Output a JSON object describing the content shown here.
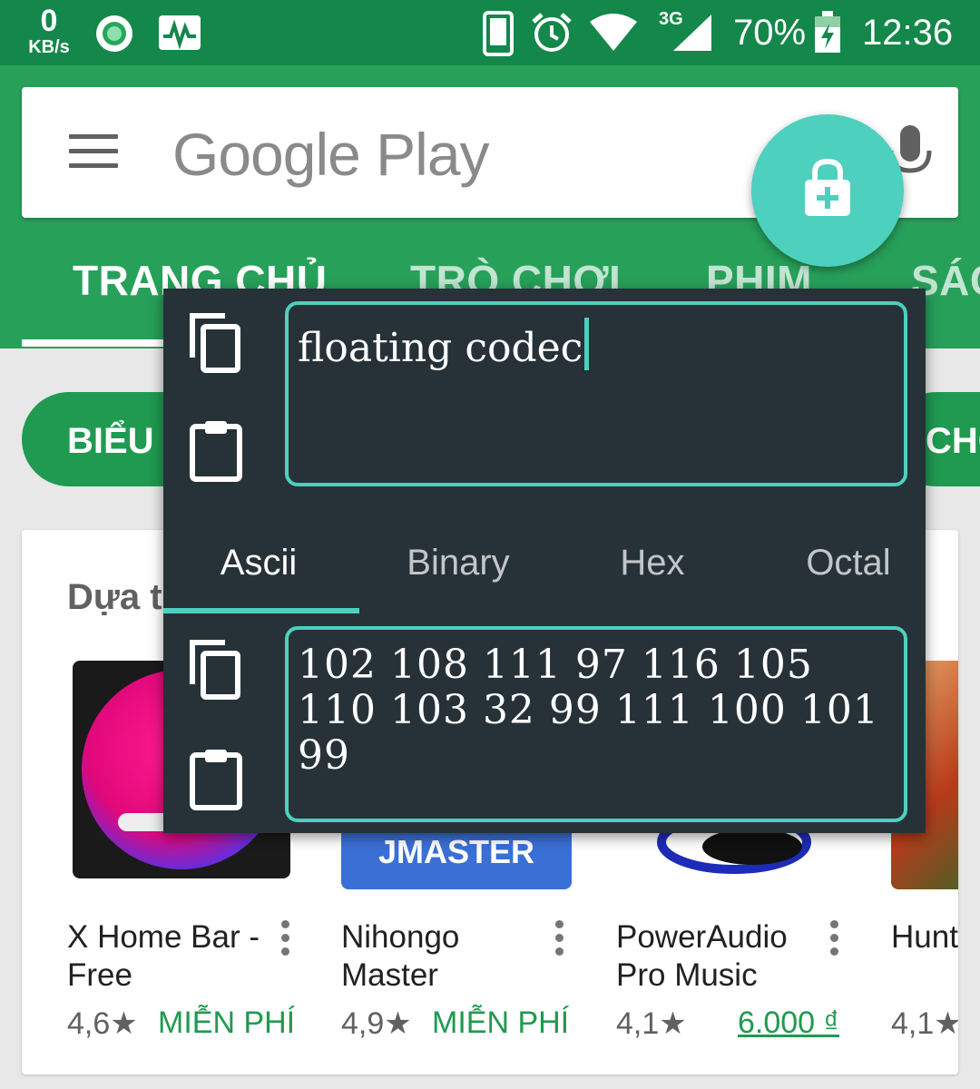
{
  "status_bar": {
    "net_speed_value": "0",
    "net_speed_unit": "KB/s",
    "network_type": "3G",
    "battery": "70%",
    "time": "12:36"
  },
  "search": {
    "logo_text": "Google Play"
  },
  "tabs": [
    {
      "label": "TRANG CHỦ",
      "active": true
    },
    {
      "label": "TRÒ CHƠI",
      "active": false
    },
    {
      "label": "PHIM",
      "active": false
    },
    {
      "label": "SÁC",
      "active": false
    }
  ],
  "chips": {
    "left": "BIỂU ĐỒ",
    "right": "CHO"
  },
  "card": {
    "title": "Dựa trên",
    "apps": [
      {
        "name": "X Home Bar - Free",
        "rating": "4,6★",
        "price": "MIỄN PHÍ"
      },
      {
        "name": "Nihongo Master",
        "rating": "4,9★",
        "price": "MIỄN PHÍ",
        "thumb_text": "JMASTER"
      },
      {
        "name": "PowerAudio Pro Music",
        "rating": "4,1★",
        "price": "6.000 ₫"
      },
      {
        "name": "Hunt Lege",
        "rating": "4,1★",
        "price": ""
      }
    ]
  },
  "overlay": {
    "input_text": "floating codec",
    "tabs": [
      "Ascii",
      "Binary",
      "Hex",
      "Octal"
    ],
    "active_tab": "Ascii",
    "output_text": "102 108 111 97 116 105 110 103 32 99 111 100 101 99"
  },
  "colors": {
    "status_bar": "#14874a",
    "app_bar": "#27a05a",
    "accent": "#4dd0be",
    "overlay_bg": "#263238",
    "price_green": "#1f9a50"
  },
  "icons": {
    "status": [
      "netspeed",
      "circle-app-icon",
      "activity-monitor-icon",
      "phone-icon",
      "alarm-icon",
      "wifi-icon",
      "signal-icon",
      "battery-charging-icon"
    ],
    "overlay": [
      "copy-icon",
      "paste-icon"
    ],
    "fab": "lock-add-icon",
    "search": [
      "hamburger-icon",
      "mic-icon"
    ]
  }
}
